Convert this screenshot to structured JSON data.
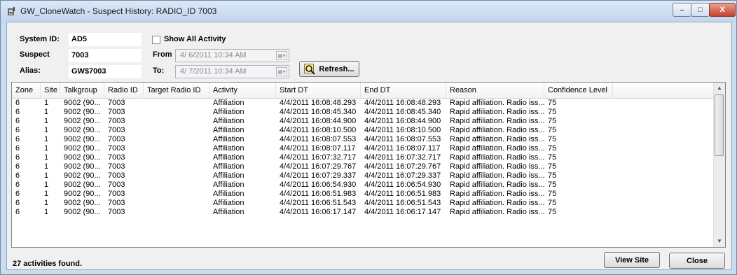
{
  "window": {
    "title": "GW_CloneWatch - Suspect History: RADIO_ID 7003",
    "minimize_glyph": "–",
    "maximize_glyph": "□",
    "close_glyph": "X"
  },
  "form": {
    "system_id_label": "System ID:",
    "system_id_value": "AD5",
    "suspect_label": "Suspect",
    "suspect_value": "7003",
    "alias_label": "Alias:",
    "alias_value": "GW$7003",
    "show_all_label": "Show All Activity",
    "show_all_checked": false,
    "from_label": "From",
    "from_value": "4/ 6/2011 10:34 AM",
    "to_label": "To:",
    "to_value": "4/ 7/2011 10:34 AM",
    "refresh_label": "Refresh..."
  },
  "grid": {
    "columns": [
      "Zone",
      "Site",
      "Talkgroup",
      "Radio ID",
      "Target Radio ID",
      "Activity",
      "Start DT",
      "End DT",
      "Reason",
      "Confidence Level"
    ],
    "rows": [
      [
        "6",
        "1",
        "9002 (90...",
        "7003",
        "",
        "Affiliation",
        "4/4/2011 16:08:48.293",
        "4/4/2011 16:08:48.293",
        "Rapid affiliation. Radio iss...",
        "75"
      ],
      [
        "6",
        "1",
        "9002 (90...",
        "7003",
        "",
        "Affiliation",
        "4/4/2011 16:08:45.340",
        "4/4/2011 16:08:45.340",
        "Rapid affiliation. Radio iss...",
        "75"
      ],
      [
        "6",
        "1",
        "9002 (90...",
        "7003",
        "",
        "Affiliation",
        "4/4/2011 16:08:44.900",
        "4/4/2011 16:08:44.900",
        "Rapid affiliation. Radio iss...",
        "75"
      ],
      [
        "6",
        "1",
        "9002 (90...",
        "7003",
        "",
        "Affiliation",
        "4/4/2011 16:08:10.500",
        "4/4/2011 16:08:10.500",
        "Rapid affiliation. Radio iss...",
        "75"
      ],
      [
        "6",
        "1",
        "9002 (90...",
        "7003",
        "",
        "Affiliation",
        "4/4/2011 16:08:07.553",
        "4/4/2011 16:08:07.553",
        "Rapid affiliation. Radio iss...",
        "75"
      ],
      [
        "6",
        "1",
        "9002 (90...",
        "7003",
        "",
        "Affiliation",
        "4/4/2011 16:08:07.117",
        "4/4/2011 16:08:07.117",
        "Rapid affiliation. Radio iss...",
        "75"
      ],
      [
        "6",
        "1",
        "9002 (90...",
        "7003",
        "",
        "Affiliation",
        "4/4/2011 16:07:32.717",
        "4/4/2011 16:07:32.717",
        "Rapid affiliation. Radio iss...",
        "75"
      ],
      [
        "6",
        "1",
        "9002 (90...",
        "7003",
        "",
        "Affiliation",
        "4/4/2011 16:07:29.767",
        "4/4/2011 16:07:29.767",
        "Rapid affiliation. Radio iss...",
        "75"
      ],
      [
        "6",
        "1",
        "9002 (90...",
        "7003",
        "",
        "Affiliation",
        "4/4/2011 16:07:29.337",
        "4/4/2011 16:07:29.337",
        "Rapid affiliation. Radio iss...",
        "75"
      ],
      [
        "6",
        "1",
        "9002 (90...",
        "7003",
        "",
        "Affiliation",
        "4/4/2011 16:06:54.930",
        "4/4/2011 16:06:54.930",
        "Rapid affiliation. Radio iss...",
        "75"
      ],
      [
        "6",
        "1",
        "9002 (90...",
        "7003",
        "",
        "Affiliation",
        "4/4/2011 16:06:51.983",
        "4/4/2011 16:06:51.983",
        "Rapid affiliation. Radio iss...",
        "75"
      ],
      [
        "6",
        "1",
        "9002 (90...",
        "7003",
        "",
        "Affiliation",
        "4/4/2011 16:06:51.543",
        "4/4/2011 16:06:51.543",
        "Rapid affiliation. Radio iss...",
        "75"
      ],
      [
        "6",
        "1",
        "9002 (90...",
        "7003",
        "",
        "Affiliation",
        "4/4/2011 16:06:17.147",
        "4/4/2011 16:06:17.147",
        "Rapid affiliation. Radio iss...",
        "75"
      ]
    ]
  },
  "footer": {
    "status": "27 activities found.",
    "view_site_label": "View Site",
    "close_label": "Close"
  }
}
